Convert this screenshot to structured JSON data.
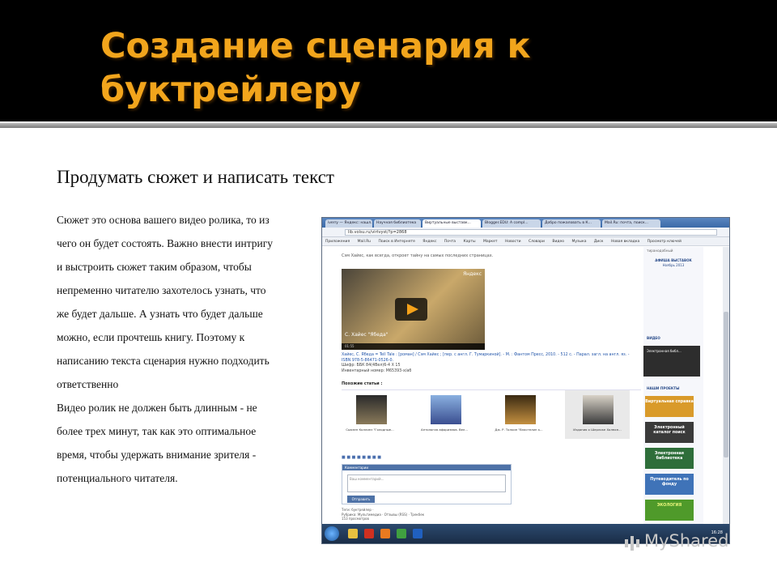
{
  "slide": {
    "title": "Создание сценария к буктрейлеру",
    "subtitle": "Продумать сюжет и написать текст",
    "paragraphs": [
      "Сюжет это основа вашего видео ролика, то из чего он будет состоять. Важно внести интригу и выстроить сюжет таким образом, чтобы непременно читателю захотелось узнать, что же будет дальше. А узнать что будет дальше можно, если прочтешь книгу. Поэтому к написанию текста сценария нужно подходить ответственно",
      "Видео ролик не должен быть длинным - не более трех минут, так как это оптимальное время, чтобы удержать внимание зрителя - потенциального читателя."
    ]
  },
  "browser": {
    "tabs": [
      "iverry — Яндекс: нашл...",
      "Научная библиотека",
      "Виртуальные выставк...",
      "Blogger.EDU: A compl...",
      "Добро пожаловать в К...",
      "Mail.Ru: почта, поиск..."
    ],
    "url": "lib.volsu.ru/virtvyst/?p=2868",
    "bookmarks": [
      "Приложения",
      "Mail.Ru",
      "Поиск в Интернете",
      "Яндекс",
      "Почта",
      "Карты",
      "Маркет",
      "Новости",
      "Словари",
      "Видео",
      "Музыка",
      "Диск",
      "Новая вкладка",
      "Просмотр ключей"
    ]
  },
  "page": {
    "lead": "Сэм Хайес, как всегда, откроет тайну на самых последних страницах.",
    "video_brand": "Яндекс",
    "video_caption": "С. Хайес \"Ябеда\"",
    "video_bar": "01:55",
    "biblio": "Хайес, С. Ябеда = Tell Tale : [роман] / Сэм Хайес ; [пер. с англ. Г. Тумаркиной]. - М. : Фантом Пресс, 2010. - 512 с. - Парал. загл. на англ. яз. - ISBN 978-5-86471-0526-0.",
    "biblio_meta": [
      "Шифр: ББК 84(4Вел)6-4 Х 15",
      "Инвентарный номер: М65393-х/аб"
    ],
    "similar_title": "Похожие статьи :",
    "similar": [
      "Сьюзен Коллинз \"Голодные...",
      "Антология афоризмов. Вел...",
      "Дж. Р. Толкин \"Властелин к...",
      "Издания о Шерлоке Холмсе..."
    ],
    "comment_header": "Комментарии",
    "comment_placeholder": "Ваш комментарий...",
    "send_label": "Отправить",
    "tags": [
      "Теги: буктрейлер ·",
      "Рубрика: Мультимедиа · Отзывы (RSS) · Трекбек",
      "153 просмотров"
    ]
  },
  "sidebar": {
    "top_link": "тиранодобный",
    "poster_head": "АФИША ВЫСТАВОК",
    "poster_sub": "Ноябрь 2013",
    "video_label": "ВИДЕО",
    "video_title": "Электронная библ...",
    "projects_label": "НАШИ ПРОЕКТЫ",
    "projects": [
      "Виртуальная справка",
      "Электронный каталог поиск",
      "Электронная библиотека",
      "Путеводитель по фонду",
      "ЭКОЛОГИЯ"
    ]
  },
  "taskbar": {
    "clock": "16:28"
  },
  "watermark": "MyShared",
  "colors": {
    "title": "#f2a51c",
    "titlebar": "#000000"
  }
}
